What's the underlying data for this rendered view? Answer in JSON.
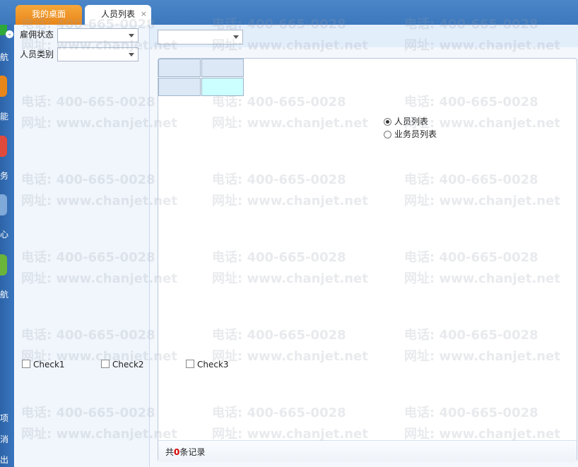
{
  "tabs": [
    {
      "label": "我的桌面",
      "active": false
    },
    {
      "label": "人员列表",
      "active": true,
      "close": "×"
    }
  ],
  "left_nav": {
    "labels": [
      "航",
      "能",
      "务",
      "心",
      "航",
      "项",
      "消",
      "出"
    ],
    "collapse_glyph": "⌄",
    "button_colors": [
      "#2fa83a",
      "#e8861a",
      "#e04a3c",
      "#7fa9d8",
      "#6bb43a"
    ]
  },
  "filters": [
    {
      "label": "雇佣状态",
      "value": ""
    },
    {
      "label": "人员类别",
      "value": ""
    }
  ],
  "main": {
    "top_select_value": ""
  },
  "view_options": [
    {
      "label": "人员列表",
      "selected": true
    },
    {
      "label": "业务员列表",
      "selected": false
    }
  ],
  "checkboxes": [
    "Check1",
    "Check2",
    "Check3"
  ],
  "footer": {
    "prefix": "共",
    "count": "0",
    "suffix": "条记录"
  },
  "watermark": {
    "phone": "电话: 400-665-0028",
    "site": "网址: www.chanjet.net"
  },
  "colors": {
    "accent": "#3d78bd",
    "tab_orange": "#e8861a",
    "count_red": "#d60000"
  }
}
